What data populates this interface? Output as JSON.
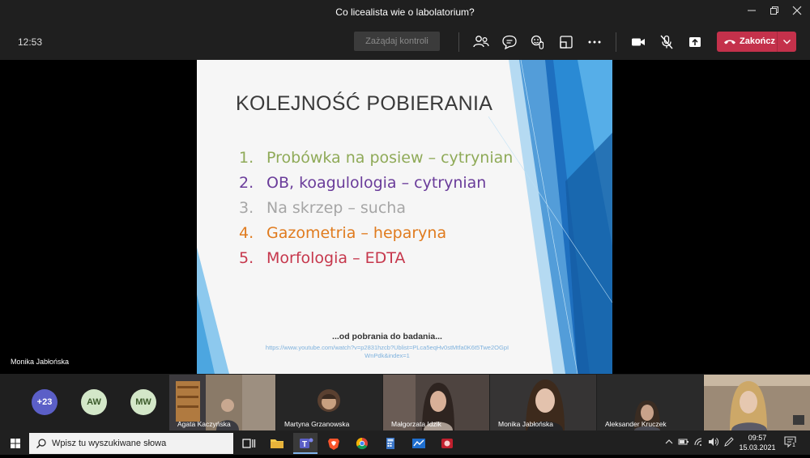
{
  "window": {
    "title": "Co licealista wie o labolatorium?"
  },
  "toolbar": {
    "time": "12:53",
    "request_control_label": "Zażądaj kontroli",
    "end_call_label": "Zakończ"
  },
  "slide": {
    "title": "KOLEJNOŚĆ POBIERANIA",
    "items": [
      {
        "num": "1.",
        "text": "Probówka na posiew – cytrynian",
        "color": "#8faa58"
      },
      {
        "num": "2.",
        "text": "OB, koagulologia – cytrynian",
        "color": "#6a3c9a"
      },
      {
        "num": "3.",
        "text": "Na skrzep – sucha",
        "color": "#a6a6a6"
      },
      {
        "num": "4.",
        "text": "Gazometria – heparyna",
        "color": "#e07b1e"
      },
      {
        "num": "5.",
        "text": "Morfologia – EDTA",
        "color": "#c6374c"
      }
    ],
    "footer_text": "...od pobrania do badania...",
    "link_line1": "https://www.youtube.com/watch?v=p2831hzcb?Ublist=PLca5eqHv0stMtfa0K6t5Twe2OGpI",
    "link_line2": "WnPdk&index=1"
  },
  "stage": {
    "speaker_name": "Monika Jabłońska"
  },
  "gallery": {
    "overflow_label": "+23",
    "avatars": [
      {
        "initials": "AW"
      },
      {
        "initials": "MW"
      }
    ],
    "participants": [
      {
        "name": "Agata Kaczyńska"
      },
      {
        "name": "Martyna Grzanowska"
      },
      {
        "name": "Małgorzata Idzik"
      },
      {
        "name": "Monika Jabłońska"
      },
      {
        "name": "Aleksander Kruczek"
      },
      {
        "name": ""
      }
    ]
  },
  "taskbar": {
    "search_placeholder": "Wpisz tu wyszukiwane słowa",
    "time": "09:57",
    "date": "15.03.2021",
    "notifications_count": "1"
  },
  "colors": {
    "accent_end": "#c4314b",
    "slide_blue": "#2a8ad4"
  }
}
